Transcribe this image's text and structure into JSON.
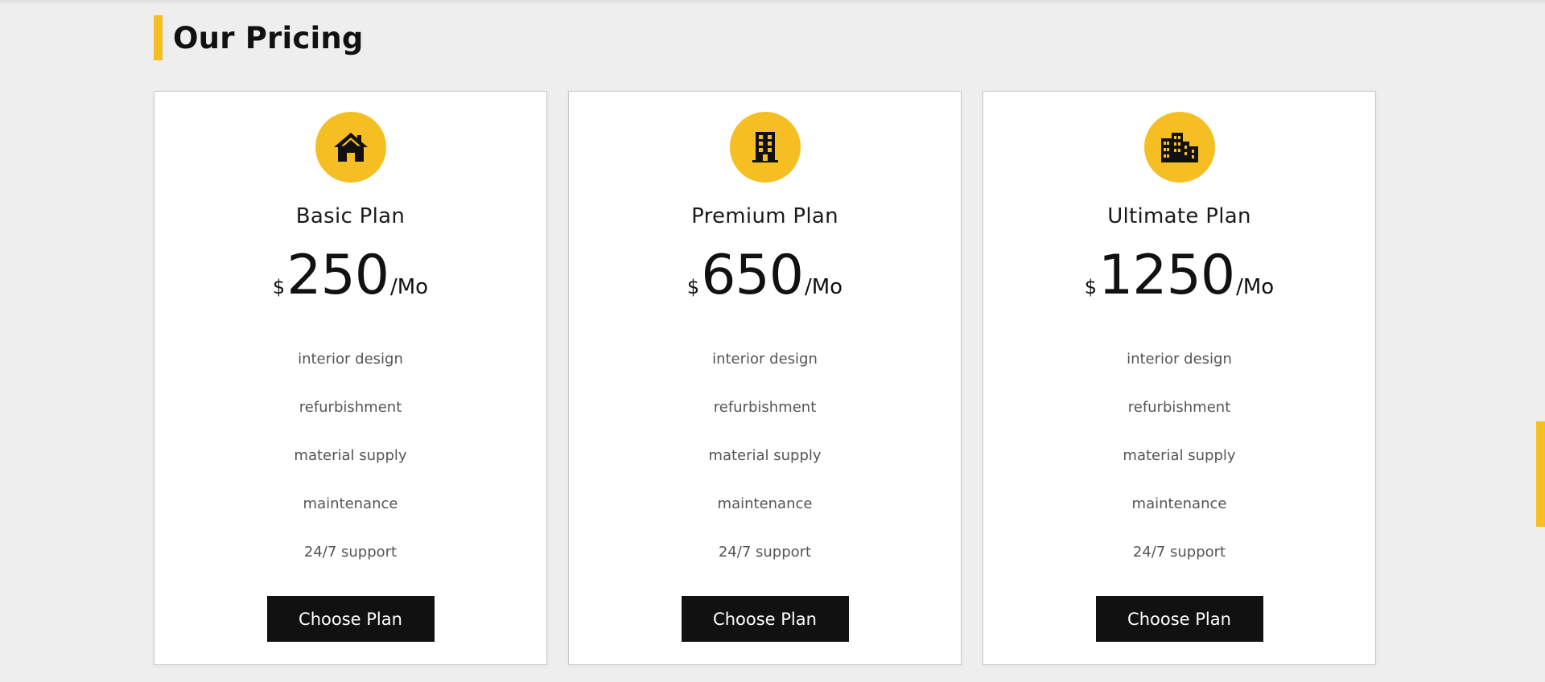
{
  "section": {
    "title": "Our Pricing"
  },
  "plans": [
    {
      "icon": "house-icon",
      "name": "Basic Plan",
      "currency": "$",
      "amount": "250",
      "period": "/Mo",
      "features": [
        "interior design",
        "refurbishment",
        "material supply",
        "maintenance",
        "24/7 support"
      ],
      "button_label": "Choose Plan"
    },
    {
      "icon": "building-icon",
      "name": "Premium Plan",
      "currency": "$",
      "amount": "650",
      "period": "/Mo",
      "features": [
        "interior design",
        "refurbishment",
        "material supply",
        "maintenance",
        "24/7 support"
      ],
      "button_label": "Choose Plan"
    },
    {
      "icon": "city-icon",
      "name": "Ultimate Plan",
      "currency": "$",
      "amount": "1250",
      "period": "/Mo",
      "features": [
        "interior design",
        "refurbishment",
        "material supply",
        "maintenance",
        "24/7 support"
      ],
      "button_label": "Choose Plan"
    }
  ],
  "colors": {
    "accent": "#f5be22",
    "background": "#eeeeee",
    "button": "#111111",
    "text": "#111111",
    "muted_text": "#555555"
  }
}
